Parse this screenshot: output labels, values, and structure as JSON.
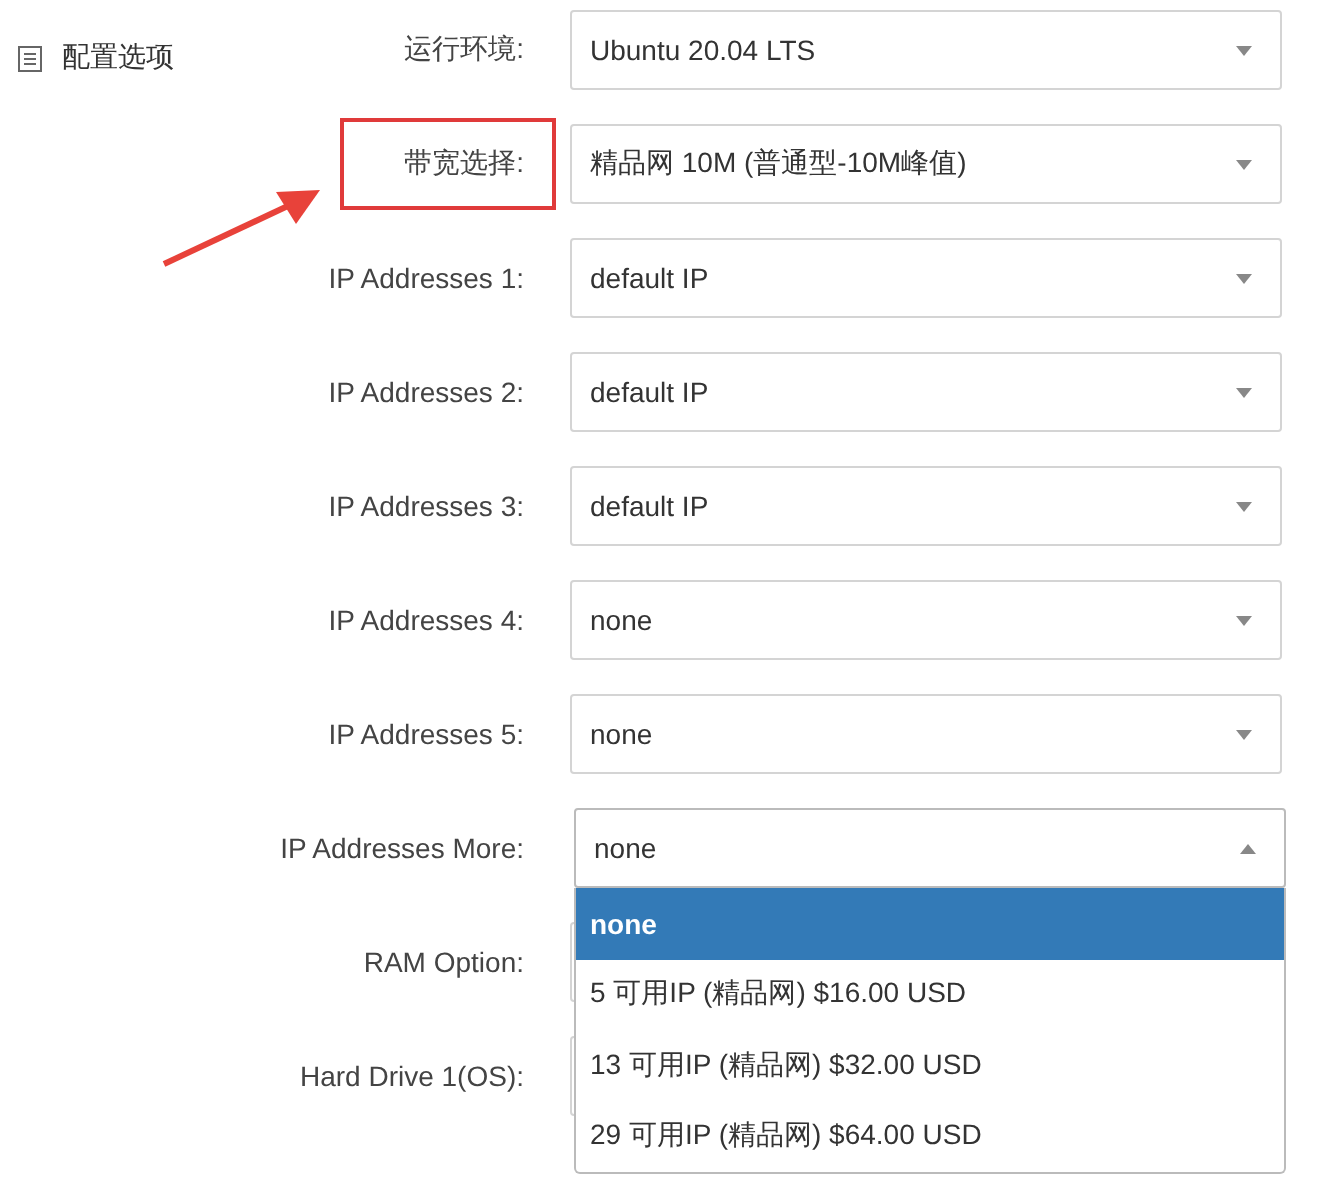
{
  "section": {
    "title": "配置选项"
  },
  "fields": [
    {
      "label": "运行环境:",
      "value": "Ubuntu 20.04 LTS",
      "annotated": false,
      "open": false
    },
    {
      "label": "带宽选择:",
      "value": "精品网 10M (普通型-10M峰值)",
      "annotated": true,
      "open": false
    },
    {
      "label": "IP Addresses 1:",
      "value": "default IP",
      "annotated": false,
      "open": false
    },
    {
      "label": "IP Addresses 2:",
      "value": "default IP",
      "annotated": false,
      "open": false
    },
    {
      "label": "IP Addresses 3:",
      "value": "default IP",
      "annotated": false,
      "open": false
    },
    {
      "label": "IP Addresses 4:",
      "value": "none",
      "annotated": false,
      "open": false
    },
    {
      "label": "IP Addresses 5:",
      "value": "none",
      "annotated": false,
      "open": false
    },
    {
      "label": "IP Addresses More:",
      "value": "none",
      "annotated": false,
      "open": true,
      "options": [
        {
          "label": "none",
          "selected": true
        },
        {
          "label": "5 可用IP (精品网) $16.00 USD",
          "selected": false
        },
        {
          "label": "13 可用IP (精品网) $32.00 USD",
          "selected": false
        },
        {
          "label": "29 可用IP (精品网) $64.00 USD",
          "selected": false
        }
      ]
    },
    {
      "label": "RAM Option:",
      "annotated": false,
      "open": false
    },
    {
      "label": "Hard Drive 1(OS):",
      "annotated": false,
      "open": false
    }
  ]
}
